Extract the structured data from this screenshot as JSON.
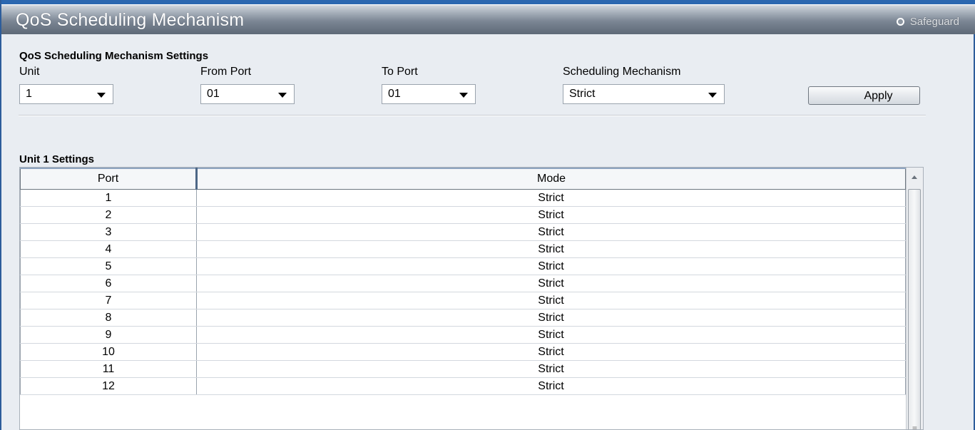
{
  "window": {
    "title": "QoS Scheduling Mechanism",
    "safeguard_label": "Safeguard"
  },
  "settings": {
    "title": "QoS Scheduling Mechanism Settings",
    "unit": {
      "label": "Unit",
      "value": "1"
    },
    "from_port": {
      "label": "From Port",
      "value": "01"
    },
    "to_port": {
      "label": "To Port",
      "value": "01"
    },
    "scheduling": {
      "label": "Scheduling Mechanism",
      "value": "Strict"
    },
    "apply_label": "Apply"
  },
  "unit_settings": {
    "title": "Unit 1 Settings",
    "columns": [
      "Port",
      "Mode"
    ],
    "rows": [
      [
        "1",
        "Strict"
      ],
      [
        "2",
        "Strict"
      ],
      [
        "3",
        "Strict"
      ],
      [
        "4",
        "Strict"
      ],
      [
        "5",
        "Strict"
      ],
      [
        "6",
        "Strict"
      ],
      [
        "7",
        "Strict"
      ],
      [
        "8",
        "Strict"
      ],
      [
        "9",
        "Strict"
      ],
      [
        "10",
        "Strict"
      ],
      [
        "11",
        "Strict"
      ],
      [
        "12",
        "Strict"
      ]
    ]
  }
}
